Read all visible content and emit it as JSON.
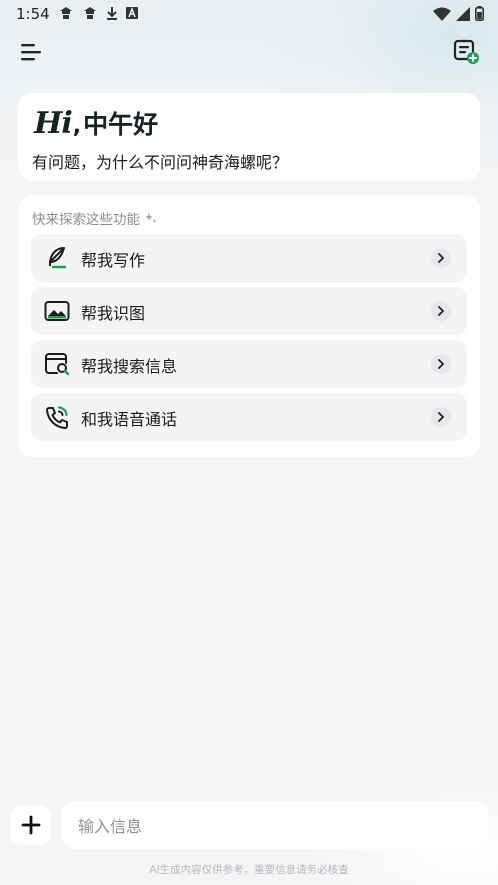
{
  "status_bar": {
    "time": "1:54",
    "left_icons": [
      "cloud-icon",
      "cloud-icon",
      "download-icon",
      "font-icon"
    ],
    "right_icons": [
      "wifi-icon",
      "signal-icon",
      "battery-icon"
    ]
  },
  "header": {
    "menu_icon": "menu-icon",
    "new_chat_icon": "new-chat-icon"
  },
  "greeting": {
    "hi": "Hi",
    "comma": ",",
    "salutation": "中午好",
    "subtitle": "有问题，为什么不问问神奇海螺呢？"
  },
  "features": {
    "heading": "快来探索这些功能",
    "items": [
      {
        "label": "帮我写作",
        "icon": "feather-pen-icon"
      },
      {
        "label": "帮我识图",
        "icon": "image-scan-icon"
      },
      {
        "label": "帮我搜索信息",
        "icon": "browser-search-icon"
      },
      {
        "label": "和我语音通话",
        "icon": "phone-call-icon"
      }
    ]
  },
  "composer": {
    "placeholder": "输入信息",
    "plus_icon": "plus-icon"
  },
  "disclaimer": "AI生成内容仅供参考，重要信息请务必核查",
  "colors": {
    "brand_green": "#1f9e55",
    "title_dark": "#14241e",
    "background": "#f4f5f7"
  }
}
